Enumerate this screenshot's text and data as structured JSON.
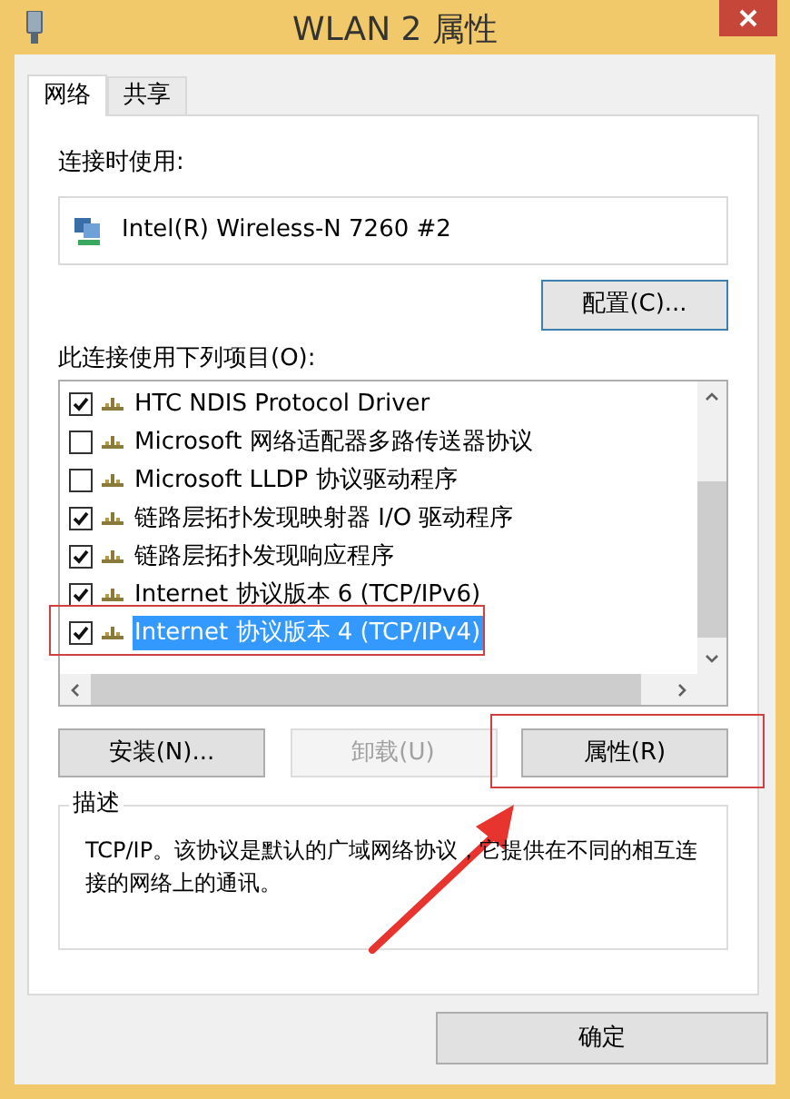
{
  "window": {
    "title": "WLAN 2 属性"
  },
  "tabs": [
    {
      "label": "网络",
      "selected": true
    },
    {
      "label": "共享",
      "selected": false
    }
  ],
  "connect_using": {
    "label": "连接时使用:",
    "adapter": "Intel(R) Wireless-N 7260 #2"
  },
  "configure_button": "配置(C)...",
  "items_label": "此连接使用下列项目(O):",
  "items": [
    {
      "label": "HTC NDIS Protocol Driver",
      "checked": true,
      "selected": false
    },
    {
      "label": "Microsoft 网络适配器多路传送器协议",
      "checked": false,
      "selected": false
    },
    {
      "label": "Microsoft LLDP 协议驱动程序",
      "checked": false,
      "selected": false
    },
    {
      "label": "链路层拓扑发现映射器 I/O 驱动程序",
      "checked": true,
      "selected": false
    },
    {
      "label": "链路层拓扑发现响应程序",
      "checked": true,
      "selected": false
    },
    {
      "label": "Internet 协议版本 6 (TCP/IPv6)",
      "checked": true,
      "selected": false
    },
    {
      "label": "Internet 协议版本 4 (TCP/IPv4)",
      "checked": true,
      "selected": true
    }
  ],
  "buttons": [
    {
      "label": "安装(N)...",
      "disabled": false
    },
    {
      "label": "卸载(U)",
      "disabled": true
    },
    {
      "label": "属性(R)",
      "disabled": false
    }
  ],
  "description": {
    "title": "描述",
    "text": "TCP/IP。该协议是默认的广域网络协议，它提供在不同的相互连接的网络上的通讯。"
  },
  "ok_button": "确定"
}
